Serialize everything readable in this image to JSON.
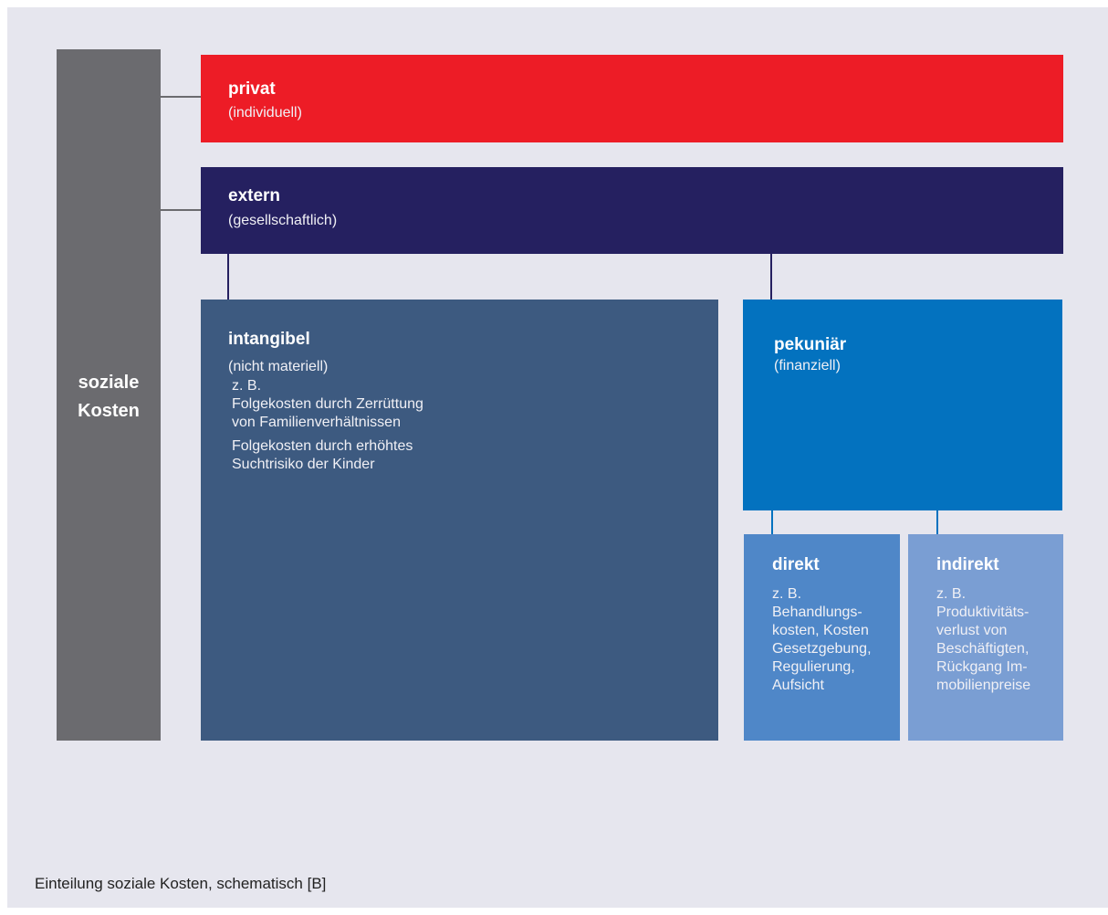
{
  "colors": {
    "sozial": "#6b6b6f",
    "privat": "#ed1c26",
    "extern": "#252060",
    "intangibel": "#3d5a80",
    "pekuniar": "#0372bf",
    "direkt": "#4f87c8",
    "indirekt": "#7a9ed3"
  },
  "sozial": {
    "line1": "soziale",
    "line2": "Kosten"
  },
  "privat": {
    "title": "privat",
    "sub": "(individuell)"
  },
  "extern": {
    "title": "extern",
    "sub": "(gesellschaftlich)"
  },
  "intangibel": {
    "title": "intangibel",
    "sub": "(nicht materiell)",
    "ex_intro": "z. B.",
    "ex1_l1": "Folgekosten durch Zerrüttung",
    "ex1_l2": "von Familienverhältnissen",
    "ex2_l1": "Folgekosten durch erhöhtes",
    "ex2_l2": "Suchtrisiko der Kinder"
  },
  "pekuniar": {
    "title": "pekuniär",
    "sub": "(finanziell)"
  },
  "direkt": {
    "title": "direkt",
    "lines": [
      "z. B.",
      "Behandlungs-",
      "kosten, Kosten",
      "Gesetzgebung,",
      "Regulierung,",
      "Aufsicht"
    ]
  },
  "indirekt": {
    "title": "indirekt",
    "lines": [
      "z. B.",
      "Produktivitäts-",
      "verlust von",
      "Beschäftigten,",
      "Rückgang Im-",
      "mobilienpreise"
    ]
  },
  "caption": "Einteilung soziale Kosten, schematisch [B]"
}
